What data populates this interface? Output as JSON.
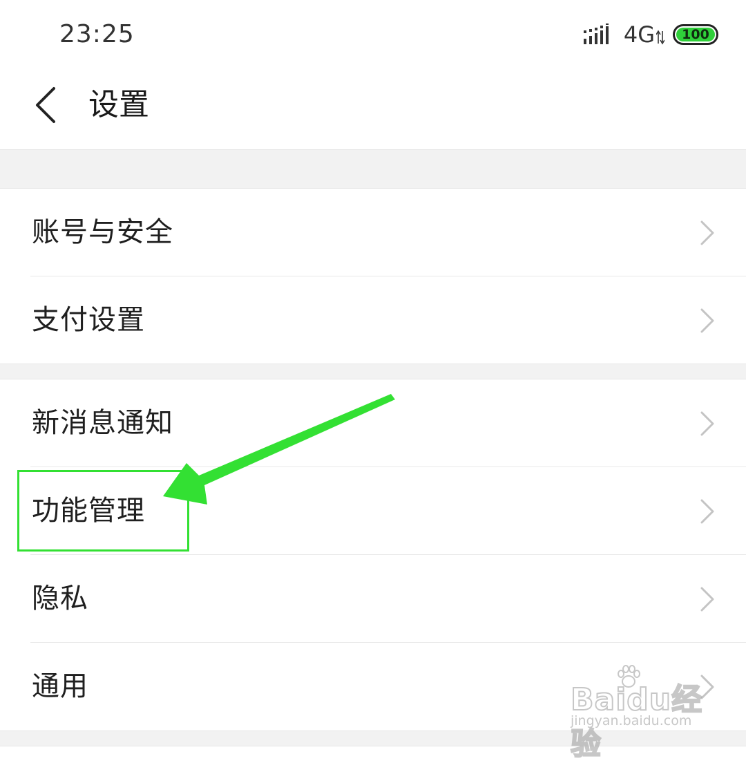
{
  "status_bar": {
    "time": "23:25",
    "network": "4G",
    "battery": "100",
    "icons": [
      "signal-bars-icon",
      "data-arrows-icon",
      "battery-icon"
    ],
    "battery_color": "#2fd03a"
  },
  "header": {
    "back_icon": "chevron-left-icon",
    "title": "设置"
  },
  "groups": [
    {
      "items": [
        {
          "label": "账号与安全",
          "icon": "chevron-right-icon"
        },
        {
          "label": "支付设置",
          "icon": "chevron-right-icon"
        }
      ]
    },
    {
      "items": [
        {
          "label": "新消息通知",
          "icon": "chevron-right-icon"
        },
        {
          "label": "功能管理",
          "icon": "chevron-right-icon",
          "highlighted": true
        },
        {
          "label": "隐私",
          "icon": "chevron-right-icon"
        },
        {
          "label": "通用",
          "icon": "chevron-right-icon"
        }
      ]
    }
  ],
  "annotation": {
    "color": "#33e033",
    "target": "功能管理"
  },
  "watermark": {
    "brand": "Baidu经验",
    "site": "jingyan.baidu.com"
  }
}
